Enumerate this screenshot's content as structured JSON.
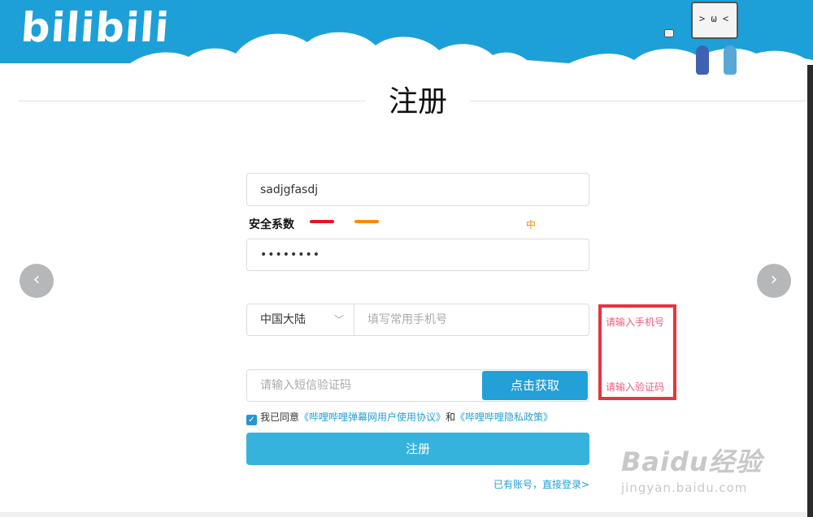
{
  "header": {
    "logo_text": "bilibili",
    "mascot_face": "> ω <",
    "sky_color": "#1da0d8"
  },
  "page": {
    "title": "注册"
  },
  "form": {
    "username_value": "sadjgfasdj",
    "strength_label": "安全系数",
    "strength_level": "中",
    "strength_colors": [
      "#e8141e",
      "#ff8a00"
    ],
    "password_value": "••••••••",
    "region_selected": "中国大陆",
    "phone_placeholder": "填写常用手机号",
    "sms_placeholder": "请输入短信验证码",
    "get_code_label": "点击获取",
    "agree_text": "我已同意",
    "agreement_link_1": "《哔哩哔哩弹幕网用户使用协议》",
    "agree_and": "和",
    "agreement_link_2": "《哔哩哔哩隐私政策》",
    "submit_label": "注册",
    "login_link": "已有账号，直接登录>"
  },
  "hints": {
    "phone_hint": "请输入手机号",
    "code_hint": "请输入验证码",
    "box_color": "#e9333f"
  },
  "watermark": {
    "main": "Baidu经验",
    "sub": "jingyan.baidu.com"
  }
}
